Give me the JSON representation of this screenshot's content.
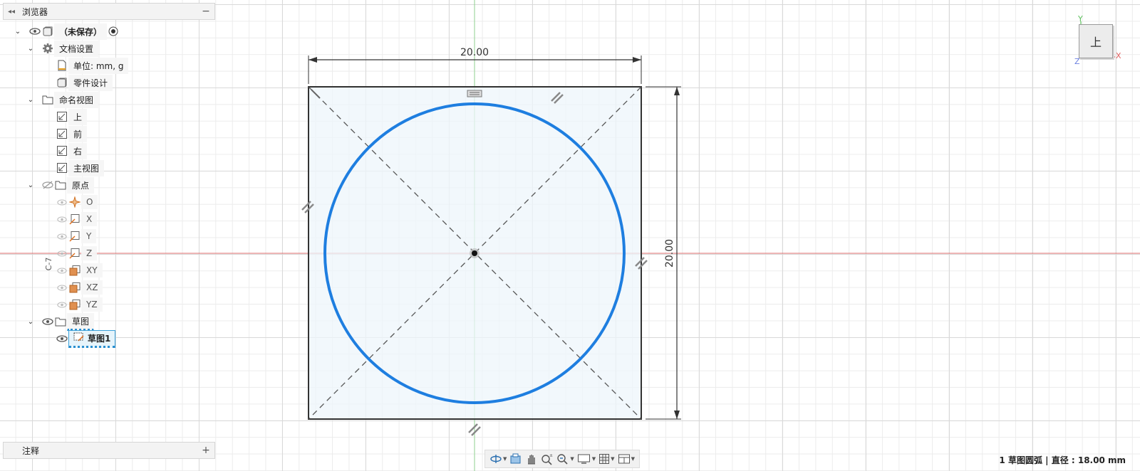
{
  "browser": {
    "title": "浏览器",
    "root": "（未保存）",
    "doc_settings": "文档设置",
    "units": "单位: mm, g",
    "design_type": "零件设计",
    "named_views": "命名视图",
    "views": [
      "上",
      "前",
      "右",
      "主视图"
    ],
    "origin": "原点",
    "origin_items": [
      "O",
      "X",
      "Y",
      "Z",
      "XY",
      "XZ",
      "YZ"
    ],
    "sketches": "草图",
    "sketch1": "草图1"
  },
  "annotations": {
    "title": "注释"
  },
  "canvas": {
    "dim_horizontal": "20.00",
    "dim_vertical": "20.00",
    "side_glyph": "C-7"
  },
  "viewcube": {
    "face": "上",
    "axis_y": "Y",
    "axis_x": "X",
    "axis_z": "Z"
  },
  "navbar": {
    "tools": [
      "orbit-icon",
      "look-at-icon",
      "pan-icon",
      "zoom-icon",
      "fit-icon",
      "display-settings-icon",
      "grid-icon",
      "viewports-icon"
    ]
  },
  "status": {
    "text": "1 草图圆弧 | 直径 : 18.00 mm"
  },
  "colors": {
    "accent_blue": "#1e7ee0",
    "sketch_fill": "#eef6fb",
    "axis_red": "#e06060",
    "axis_green": "#7ccf7c"
  }
}
